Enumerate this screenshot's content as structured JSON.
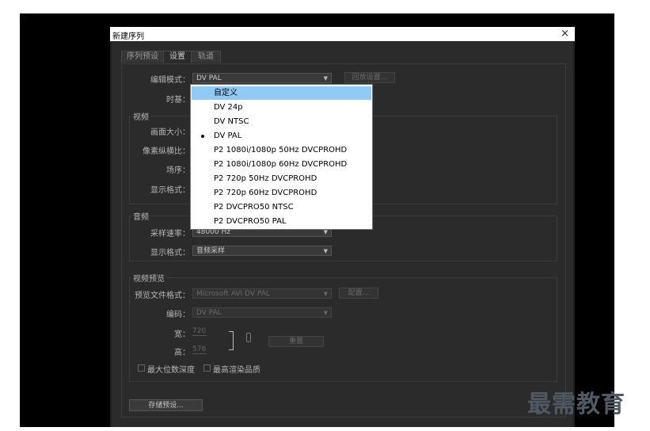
{
  "window": {
    "title": "新建序列",
    "close_icon": "×"
  },
  "tabs": [
    {
      "label": "序列预设"
    },
    {
      "label": "设置"
    },
    {
      "label": "轨道"
    }
  ],
  "settings": {
    "edit_mode_label": "编辑模式：",
    "edit_mode_value": "DV PAL",
    "playback_button": "回放设置...",
    "timebase_label": "时基："
  },
  "video": {
    "group_title": "视频",
    "frame_size_label": "画面大小：",
    "pixel_aspect_label": "像素纵横比：",
    "fields_label": "场序：",
    "display_format_label": "显示格式："
  },
  "audio": {
    "group_title": "音频",
    "sample_rate_label": "采样速率：",
    "sample_rate_value": "48000 Hz",
    "display_format_label": "显示格式：",
    "display_format_value": "音频采样"
  },
  "preview": {
    "group_title": "视频预览",
    "file_format_label": "预览文件格式：",
    "file_format_value": "Microsoft AVI DV PAL",
    "config_button": "配置...",
    "codec_label": "编码：",
    "codec_value": "DV PAL",
    "width_label": "宽：",
    "width_value": "720",
    "height_label": "高：",
    "height_value": "576",
    "reset_button": "重置",
    "max_bit_depth": "最大位数深度",
    "max_render_quality": "最高渲染品质"
  },
  "save_preset_button": "存储预设...",
  "menu": {
    "items": [
      {
        "label": "自定义"
      },
      {
        "label": "DV 24p"
      },
      {
        "label": "DV NTSC"
      },
      {
        "label": "DV PAL"
      },
      {
        "label": "P2 1080i/1080p 50Hz DVCPROHD"
      },
      {
        "label": "P2 1080i/1080p 60Hz DVCPROHD"
      },
      {
        "label": "P2 720p 50Hz DVCPROHD"
      },
      {
        "label": "P2 720p 60Hz DVCPROHD"
      },
      {
        "label": "P2 DVCPRO50 NTSC"
      },
      {
        "label": "P2 DVCPRO50 PAL"
      }
    ],
    "highlighted": "自定义",
    "checked": "DV PAL"
  },
  "watermark": "最需教育"
}
